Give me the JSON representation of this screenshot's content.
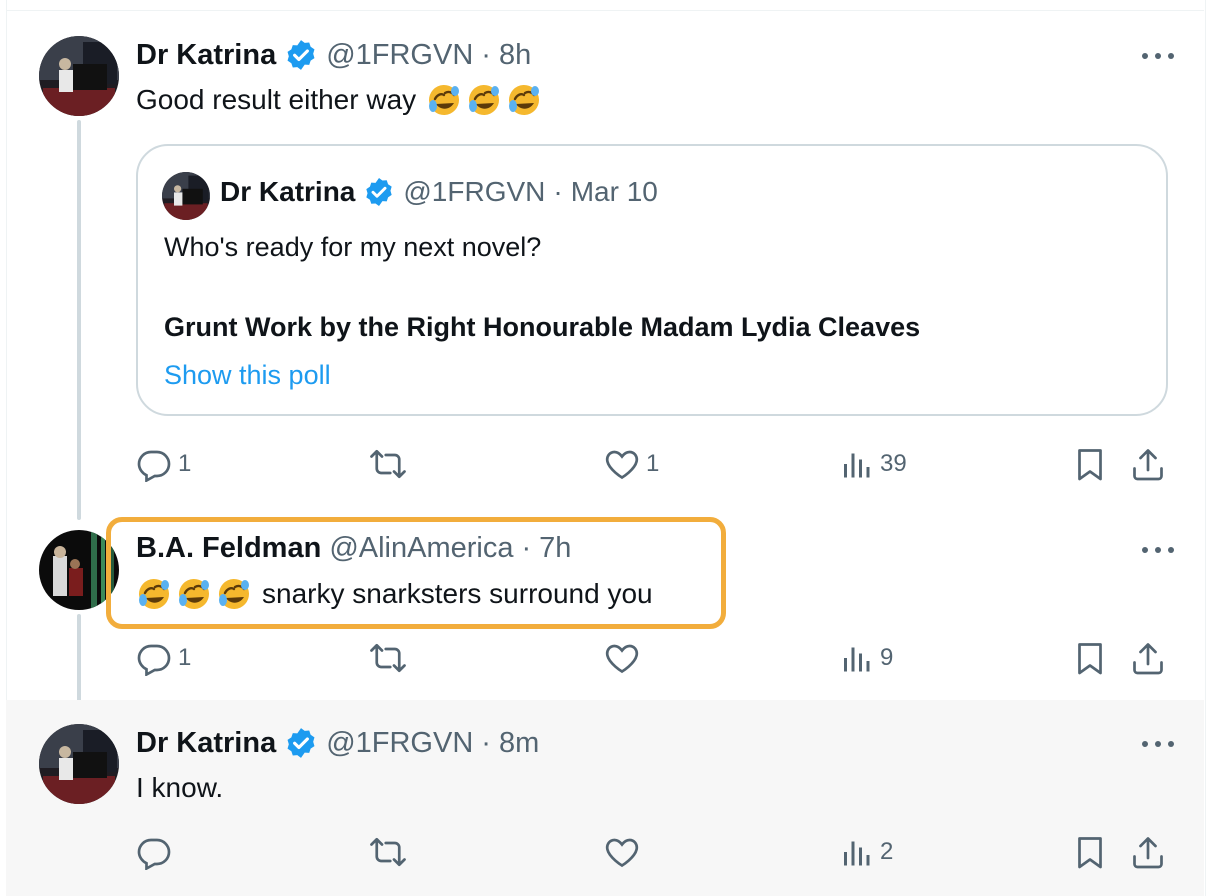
{
  "tweets": [
    {
      "author_name": "Dr Katrina",
      "handle": "@1FRGVN",
      "separator": "·",
      "time": "8h",
      "verified": true,
      "text": "Good result either way",
      "emoji_count": 3,
      "quote": {
        "author_name": "Dr Katrina",
        "handle": "@1FRGVN",
        "separator": "·",
        "time": "Mar 10",
        "line1": "Who's ready for my next novel?",
        "line2": "Grunt Work by the Right Honourable Madam Lydia Cleaves",
        "poll_link": "Show this poll"
      },
      "stats": {
        "replies": "1",
        "retweets": "",
        "likes": "1",
        "views": "39"
      }
    },
    {
      "author_name": "B.A. Feldman",
      "handle": "@AlinAmerica",
      "separator": "·",
      "time": "7h",
      "verified": false,
      "text": "snarky snarksters surround you",
      "emoji_count": 3,
      "highlighted_box": true,
      "stats": {
        "replies": "1",
        "retweets": "",
        "likes": "",
        "views": "9"
      }
    },
    {
      "author_name": "Dr Katrina",
      "handle": "@1FRGVN",
      "separator": "·",
      "time": "8m",
      "verified": true,
      "text": "I know.",
      "stats": {
        "replies": "",
        "retweets": "",
        "likes": "",
        "views": "2"
      }
    }
  ],
  "colors": {
    "accent": "#1d9bf0",
    "secondary_text": "#536471",
    "highlight_box": "#f2ad3c",
    "thread_line": "#cfd9de",
    "selected_row_bg": "#f7f7f7"
  },
  "icons": {
    "reply": "reply-icon",
    "retweet": "retweet-icon",
    "like": "like-icon",
    "views": "views-icon",
    "bookmark": "bookmark-icon",
    "share": "share-icon",
    "more": "more-icon",
    "verified": "verified-badge-icon",
    "emoji": "rolling-on-floor-laughing-emoji"
  }
}
